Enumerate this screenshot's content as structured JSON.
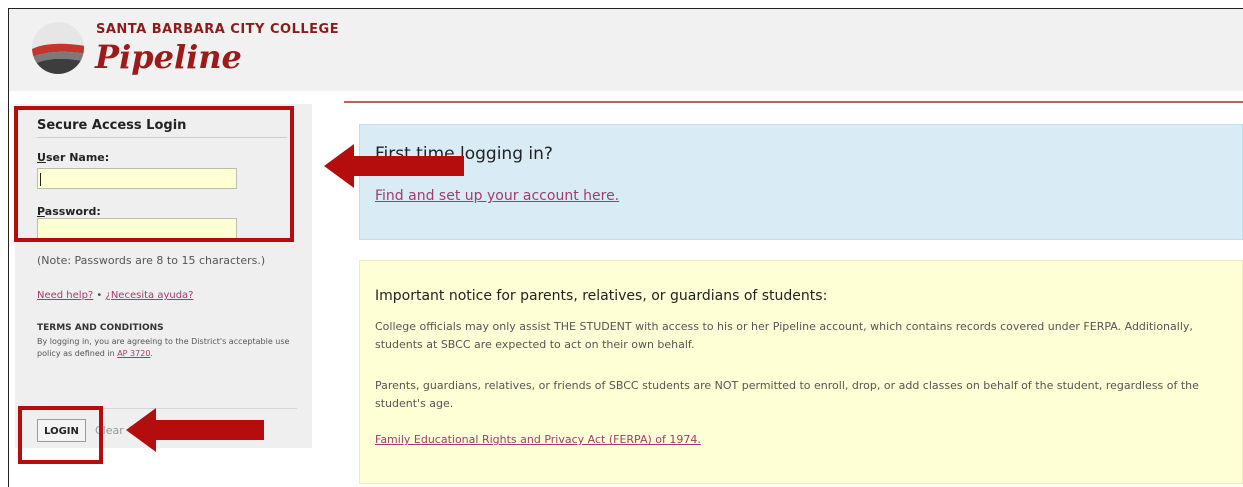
{
  "header": {
    "college": "SANTA BARBARA CITY COLLEGE",
    "app_name": "Pipeline"
  },
  "login": {
    "title": "Secure Access Login",
    "username_label_key": "U",
    "username_label_rest": "ser Name:",
    "username_value": "",
    "password_label_key": "P",
    "password_label_rest": "assword:",
    "password_value": "",
    "note": "(Note: Passwords are 8 to 15 characters.)",
    "help_link": "Need help?",
    "help_sep": " • ",
    "help_link_es": "¿Necesita ayuda?",
    "terms_heading": "TERMS AND CONDITIONS",
    "terms_text": "By logging in, you are agreeing to the District's acceptable use policy as defined in ",
    "terms_link": "AP 3720",
    "terms_end": ".",
    "login_button": "LOGIN",
    "clear_text": "Clear"
  },
  "first_time": {
    "title": "First time logging in?",
    "link": "Find and set up your account here."
  },
  "notice": {
    "title": "Important notice for parents, relatives, or guardians of students:",
    "p1": "College officials may only assist THE STUDENT with access to his or her Pipeline account, which contains records covered under FERPA. Additionally, students at SBCC are expected to act on their own behalf.",
    "p2": "Parents, guardians, relatives, or friends of SBCC students are NOT permitted to enroll, drop, or add classes on behalf of the student, regardless of the student's age.",
    "link": "Family Educational Rights and Privacy Act (FERPA) of 1974."
  },
  "colors": {
    "brand": "#9b1b1b",
    "highlight": "#b50d0d",
    "link": "#a03c6c",
    "input_bg": "#ffffd4"
  },
  "icons": [
    "sbcc-logo-icon",
    "arrow-left-icon"
  ]
}
